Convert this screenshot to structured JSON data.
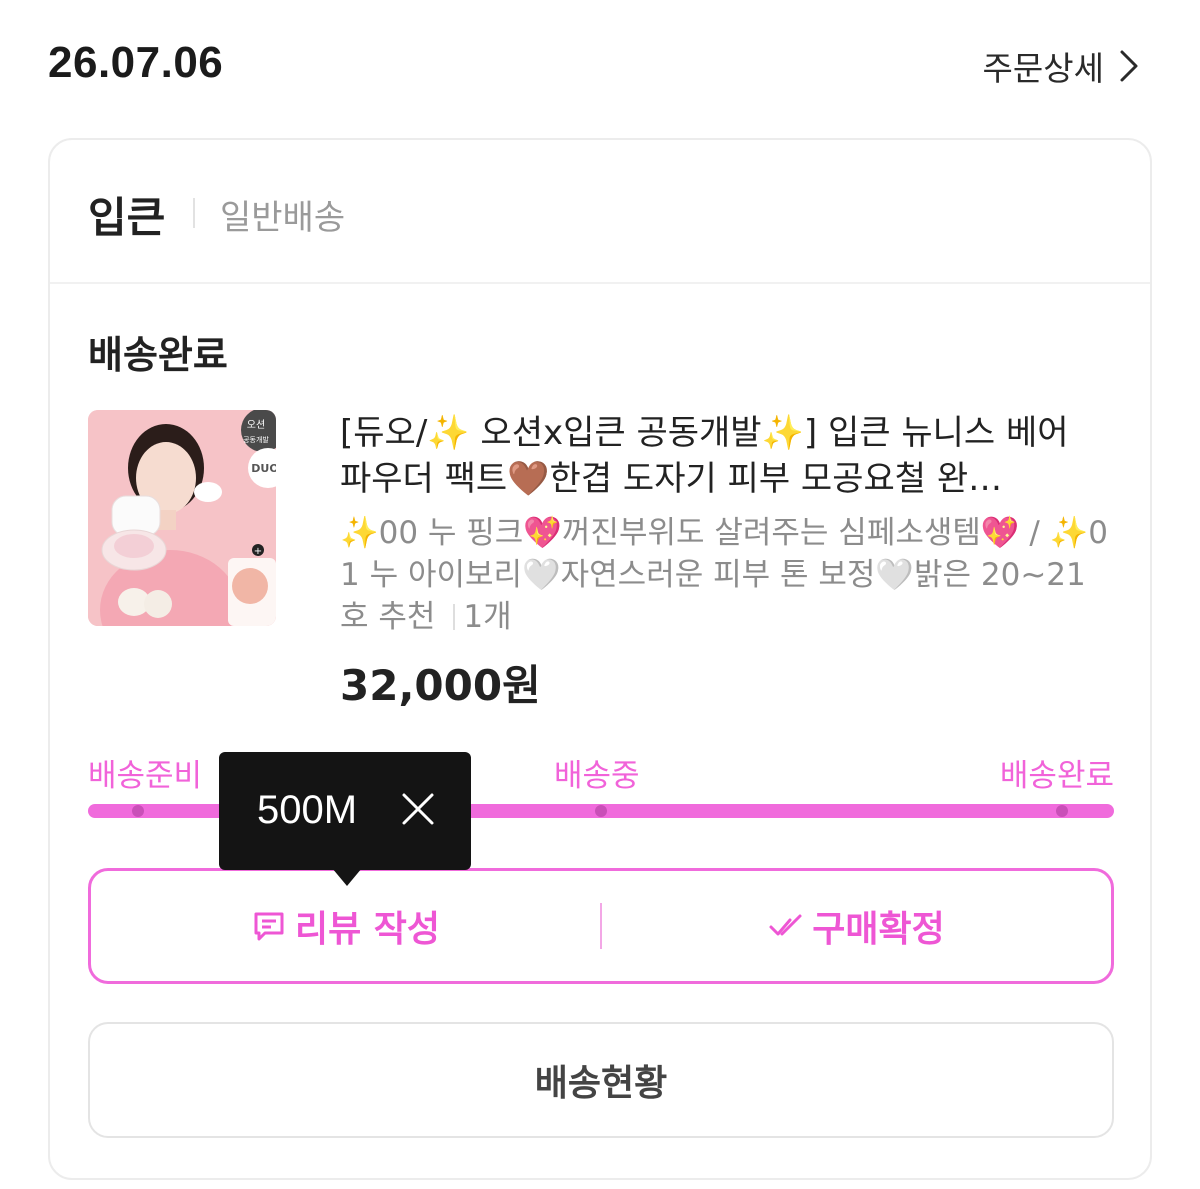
{
  "order": {
    "date": "26.07.06",
    "detail_label": "주문상세"
  },
  "seller": {
    "name": "입큰",
    "shipping_type": "일반배송"
  },
  "status": {
    "title": "배송완료"
  },
  "product": {
    "name": "[듀오/✨ 오션x입큰 공동개발✨] 입큰 뉴니스 베어 파우더 팩트🤎한겹 도자기 피부 모공요철 완…",
    "option": "✨00 누 핑크💖꺼진부위도 살려주는 심페소생템💖 / ✨01 누 아이보리🤍자연스러운 피부 톤 보정🤍밝은 20~21호 추천",
    "quantity": "1개",
    "price": "32,000원",
    "thumb_badge_top": "오션",
    "thumb_badge_sub": "공동개발",
    "thumb_badge_duo": "DUO",
    "thumb_plus": "+"
  },
  "progress": {
    "steps": [
      "배송준비",
      "배송중",
      "배송완료"
    ],
    "fill_fraction": 1.0,
    "accent_color": "#f06bdc"
  },
  "tooltip": {
    "text": "500M"
  },
  "actions": {
    "review_label": "리뷰 작성",
    "confirm_label": "구매확정",
    "tracking_label": "배송현황"
  }
}
